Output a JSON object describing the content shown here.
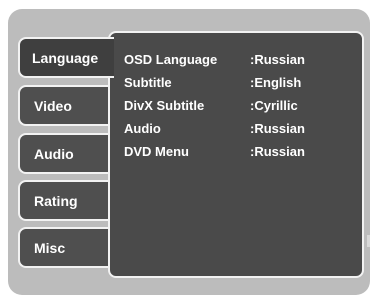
{
  "tabs": [
    {
      "label": "Language"
    },
    {
      "label": "Video"
    },
    {
      "label": "Audio"
    },
    {
      "label": "Rating"
    },
    {
      "label": "Misc"
    }
  ],
  "settings": [
    {
      "label": "OSD Language",
      "value": ":Russian"
    },
    {
      "label": "Subtitle",
      "value": ":English"
    },
    {
      "label": "DivX Subtitle",
      "value": ":Cyrillic"
    },
    {
      "label": "Audio",
      "value": ":Russian"
    },
    {
      "label": "DVD Menu",
      "value": ":Russian"
    }
  ],
  "colors": {
    "frame": "#bcbcbc",
    "panel": "#4a4a4a",
    "tab": "#4f4f4f",
    "active_tab": "#3f3f3f",
    "border": "#f2f2f2",
    "text": "#ffffff"
  }
}
